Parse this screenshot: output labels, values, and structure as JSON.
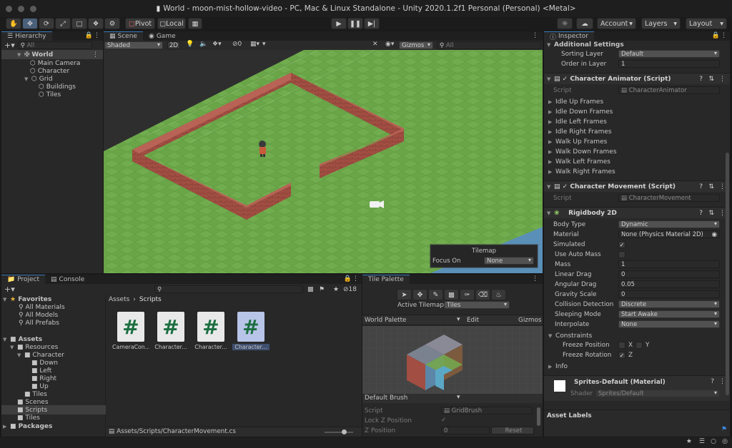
{
  "window": {
    "title": "World - moon-mist-hollow-video - PC, Mac & Linux Standalone - Unity 2020.1.2f1 Personal (Personal) <Metal>"
  },
  "toolbar": {
    "pivot": "Pivot",
    "local": "Local",
    "account": "Account",
    "layers": "Layers",
    "layout": "Layout"
  },
  "hierarchy": {
    "tab": "Hierarchy",
    "search_placeholder": "All",
    "scene": "World",
    "items": [
      "Main Camera",
      "Character",
      "Grid",
      "Buildings",
      "Tiles"
    ]
  },
  "scene": {
    "tabs": [
      "Scene",
      "Game"
    ],
    "shading": "Shaded",
    "mode2d": "2D",
    "hidden_count": "0",
    "gizmos": "Gizmos",
    "search_placeholder": "All",
    "overlay": {
      "title": "Tilemap",
      "focus_label": "Focus On",
      "focus_value": "None"
    }
  },
  "project": {
    "tabs": [
      "Project",
      "Console"
    ],
    "badge": "18",
    "favorites": {
      "label": "Favorites",
      "items": [
        "All Materials",
        "All Models",
        "All Prefabs"
      ]
    },
    "tree": {
      "assets": "Assets",
      "resources": "Resources",
      "character": "Character",
      "dirs": [
        "Down",
        "Left",
        "Right",
        "Up"
      ],
      "tiles_sub": "Tiles",
      "scenes": "Scenes",
      "scripts": "Scripts",
      "tiles": "Tiles",
      "packages": "Packages"
    },
    "breadcrumb": [
      "Assets",
      "Scripts"
    ],
    "files": [
      "CameraCon...",
      "Character...",
      "Character...",
      "Character..."
    ],
    "file_glyph": "#",
    "status_path": "Assets/Scripts/CharacterMovement.cs"
  },
  "tile_palette": {
    "tab": "Tile Palette",
    "active_label": "Active Tilemap",
    "active_value": "Tiles",
    "palette": "World Palette",
    "edit": "Edit",
    "gizmos": "Gizmos",
    "brush": "Default Brush",
    "script_label": "Script",
    "script_value": "GridBrush",
    "lockz": "Lock Z Position",
    "zpos_label": "Z Position",
    "zpos_value": "0",
    "reset": "Reset"
  },
  "inspector": {
    "tab": "Inspector",
    "additional": "Additional Settings",
    "sorting_layer_label": "Sorting Layer",
    "sorting_layer": "Default",
    "order_label": "Order in Layer",
    "order": "1",
    "animator": {
      "title": "Character Animator (Script)",
      "script_label": "Script",
      "script": "CharacterAnimator",
      "frames": [
        "Idle Up Frames",
        "Idle Down Frames",
        "Idle Left Frames",
        "Idle Right Frames",
        "Walk Up Frames",
        "Walk Down Frames",
        "Walk Left Frames",
        "Walk Right Frames"
      ]
    },
    "movement": {
      "title": "Character Movement (Script)",
      "script_label": "Script",
      "script": "CharacterMovement"
    },
    "rigidbody": {
      "title": "Rigidbody 2D",
      "body_type_label": "Body Type",
      "body_type": "Dynamic",
      "material_label": "Material",
      "material": "None (Physics Material 2D)",
      "simulated_label": "Simulated",
      "auto_mass_label": "Use Auto Mass",
      "mass_label": "Mass",
      "mass": "1",
      "linear_label": "Linear Drag",
      "linear": "0",
      "angular_label": "Angular Drag",
      "angular": "0.05",
      "gravity_label": "Gravity Scale",
      "gravity": "0",
      "collision_label": "Collision Detection",
      "collision": "Discrete",
      "sleeping_label": "Sleeping Mode",
      "sleeping": "Start Awake",
      "interp_label": "Interpolate",
      "interp": "None",
      "constraints": "Constraints",
      "fpos_label": "Freeze Position",
      "frot_label": "Freeze Rotation",
      "x": "X",
      "y": "Y",
      "z": "Z",
      "info": "Info"
    },
    "material": {
      "title": "Sprites-Default (Material)",
      "shader_label": "Shader",
      "shader": "Sprites/Default"
    },
    "asset_labels": "Asset Labels"
  },
  "colors": {
    "accent": "#3a79bb",
    "grass": "#6fa84a",
    "brick": "#9e4b3f",
    "water": "#5a8fb8"
  }
}
